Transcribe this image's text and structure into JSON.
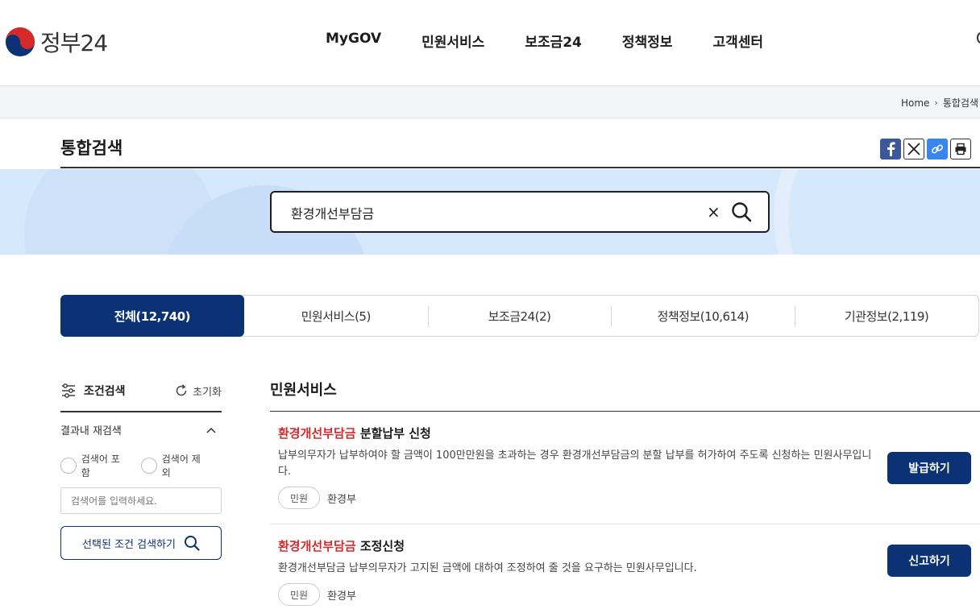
{
  "header": {
    "logo_text": "정부24",
    "nav": [
      {
        "label": "MyGOV"
      },
      {
        "label": "민원서비스"
      },
      {
        "label": "보조금24"
      },
      {
        "label": "정책정보"
      },
      {
        "label": "고객센터"
      }
    ]
  },
  "breadcrumb": {
    "home": "Home",
    "current": "통합검색"
  },
  "page": {
    "title": "통합검색"
  },
  "search": {
    "query": "환경개선부담금",
    "clear_symbol": "×"
  },
  "tabs": [
    {
      "label": "전체(12,740)",
      "active": true
    },
    {
      "label": "민원서비스(5)",
      "active": false
    },
    {
      "label": "보조금24(2)",
      "active": false
    },
    {
      "label": "정책정보(10,614)",
      "active": false
    },
    {
      "label": "기관정보(2,119)",
      "active": false
    }
  ],
  "sidebar": {
    "title": "조건검색",
    "reset_label": "초기화",
    "refine_label": "결과내 재검색",
    "include_label": "검색어 포함",
    "exclude_label": "검색어 제외",
    "input_placeholder": "검색어를 입력하세요.",
    "submit_label": "선택된 조건 검색하기"
  },
  "results": {
    "section_title": "민원서비스",
    "items": [
      {
        "highlight": "환경개선부담금",
        "rest": " 분할납부 신청",
        "desc": "납부의무자가 납부하여야 할 금액이 100만만원을 초과하는 경우 환경개선부담금의 분할 납부를 허가하여 주도록 신청하는 민원사무입니다.",
        "tag": "민원",
        "org": "환경부",
        "action": "발급하기"
      },
      {
        "highlight": "환경개선부담금",
        "rest": " 조정신청",
        "desc": "환경개선부담금 납부의무자가 고지된 금액에 대하여 조정하여 줄 것을 요구하는 민원사무입니다.",
        "tag": "민원",
        "org": "환경부",
        "action": "신고하기"
      }
    ]
  },
  "colors": {
    "primary": "#0b3275",
    "highlight": "#d62a2a",
    "banner": "#d6e8fb"
  }
}
